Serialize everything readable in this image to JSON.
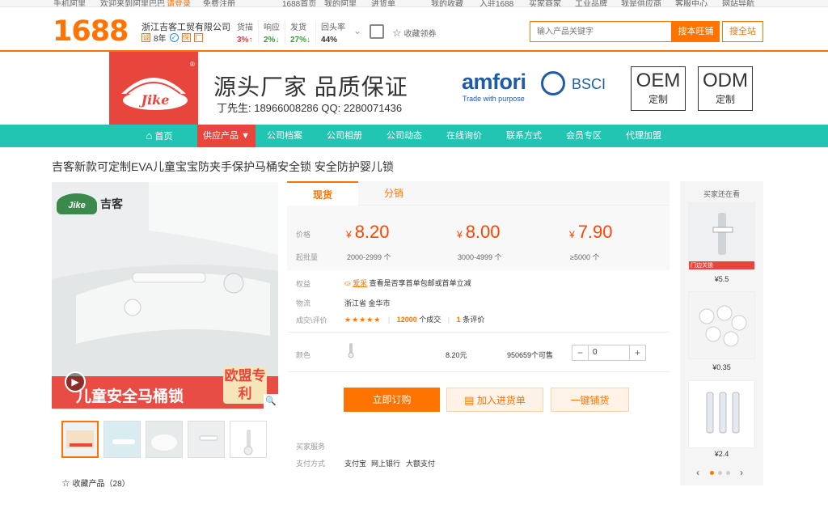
{
  "topbar": {
    "links": [
      "手机阿里",
      "欢迎来到阿里巴巴",
      "请登录",
      "免费注册",
      "1688首页",
      "我的阿里",
      "进货单",
      "我的收藏",
      "入驻1688",
      "买家商家",
      "工业品牌",
      "我是供应商",
      "客服中心",
      "网站导航"
    ]
  },
  "header": {
    "logo": "1688",
    "company": "浙江吉客工贸有限公司",
    "years": "8年",
    "stats": [
      {
        "label": "货描",
        "value": "3%↑",
        "trend": "up"
      },
      {
        "label": "响应",
        "value": "2%↓",
        "trend": "down"
      },
      {
        "label": "发货",
        "value": "27%↓",
        "trend": "down"
      },
      {
        "label": "回头率",
        "value": "44%",
        "trend": "none"
      }
    ],
    "favorite_shop": "收藏领券",
    "search_placeholder": "输入产品关键字",
    "search_button": "搜本旺铺",
    "search_all_button": "搜全站"
  },
  "banner": {
    "slogan": "源头厂家 品质保证",
    "contact": "丁先生: 18966008286 QQ: 2280071436",
    "amfori": "amfori",
    "amfori_sub": "Trade with purpose",
    "bsci": "BSCI",
    "oem": {
      "title": "OEM",
      "sub": "定制"
    },
    "odm": {
      "title": "ODM",
      "sub": "定制"
    }
  },
  "nav": {
    "items": [
      "首页",
      "供应产品 ▼",
      "公司档案",
      "公司相册",
      "公司动态",
      "在线询价",
      "联系方式",
      "会员专区",
      "代理加盟"
    ]
  },
  "product": {
    "title": "吉客新款可定制EVA儿童宝宝防夹手保护马桶安全锁 安全防护婴儿锁",
    "image_caption": "儿童安全马桶锁",
    "image_badge": "欧盟专利",
    "image_brand": "吉客",
    "favorite_label": "收藏产品（28）"
  },
  "tabs": {
    "spot": "现货",
    "distribution": "分销"
  },
  "pricing": {
    "price_label": "价格",
    "moq_label": "起批量",
    "currency": "¥",
    "tiers": [
      {
        "price": "8.20",
        "qty": "2000-2999 个"
      },
      {
        "price": "8.00",
        "qty": "3000-4999 个"
      },
      {
        "price": "7.90",
        "qty": "≥5000 个"
      }
    ]
  },
  "details": {
    "benefit_label": "权益",
    "benefit_tag": "爱采",
    "benefit_text": "查看是否享首单包邮或首单立减",
    "logistics_label": "物流",
    "logistics_value": "浙江省 金华市",
    "deal_label": "成交\\评价",
    "stars": "★★★★★",
    "deals_count": "12000",
    "deals_text": "个成交",
    "reviews_count": "1",
    "reviews_text": "条评价",
    "color_label": "颜色",
    "variant_price": "8.20元",
    "variant_stock": "950659个可售",
    "quantity": "0"
  },
  "buttons": {
    "order": "立即订购",
    "add_cart": "加入进货单",
    "dropship": "一键铺货"
  },
  "services": {
    "buyer_label": "买家服务",
    "payment_label": "支付方式",
    "payments": [
      "支付宝",
      "网上银行",
      "大额支付"
    ]
  },
  "sidebar": {
    "title": "买家还在看",
    "items": [
      {
        "price": "¥5.5",
        "caption": "门边关锁"
      },
      {
        "price": "¥0.35",
        "caption": ""
      },
      {
        "price": "¥2.4",
        "caption": ""
      }
    ]
  },
  "colors": {
    "accent": "#ff7300",
    "nav": "#22c5b2",
    "brand_red": "#e8453c",
    "price": "#ff4400"
  }
}
